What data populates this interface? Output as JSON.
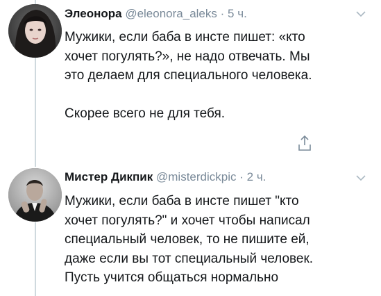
{
  "tweets": [
    {
      "name": "Элеонора",
      "handle": "@eleonora_aleks",
      "separator": "·",
      "time": "5 ч.",
      "text_lines": [
        "Мужики, если баба в инсте пишет: «кто",
        "хочет погулять?», не надо отвечать. Мы",
        "это делаем для специального человека."
      ],
      "text_para2": "Скорее всего не для тебя.",
      "avatar_icon": "user-avatar-woman",
      "share_icon": "share-icon",
      "menu_icon": "chevron-down-icon"
    },
    {
      "name": "Мистер Дикпик",
      "handle": "@misterdickpic",
      "separator": "·",
      "time": "2 ч.",
      "text_lines": [
        "Мужики, если баба в инсте пишет \"кто",
        "хочет погулять?\" и хочет чтобы написал",
        "специальный человек, то не пишите ей,",
        "даже если вы тот специальный человек.",
        "Пусть учится общаться нормально"
      ],
      "avatar_icon": "user-avatar-man",
      "menu_icon": "chevron-down-icon"
    }
  ],
  "colors": {
    "text": "#14171a",
    "meta": "#7a8a99",
    "thread_line": "#cfd9de"
  }
}
